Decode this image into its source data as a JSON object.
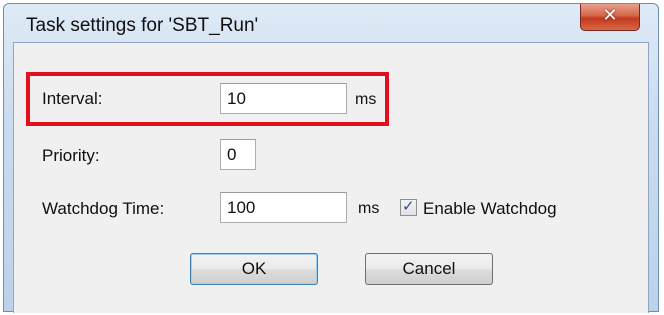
{
  "dialog": {
    "title": "Task settings for 'SBT_Run'",
    "close_icon": "close-icon"
  },
  "fields": {
    "interval": {
      "label": "Interval:",
      "value": "10",
      "unit": "ms"
    },
    "priority": {
      "label": "Priority:",
      "value": "0"
    },
    "watchdog_time": {
      "label": "Watchdog Time:",
      "value": "100",
      "unit": "ms"
    },
    "enable_watchdog": {
      "label": "Enable Watchdog",
      "checked": true
    }
  },
  "buttons": {
    "ok_label": "OK",
    "cancel_label": "Cancel"
  },
  "colors": {
    "highlight": "#e0101e",
    "close_button": "#c4391d",
    "dialog_background": "#f0f0f0"
  }
}
